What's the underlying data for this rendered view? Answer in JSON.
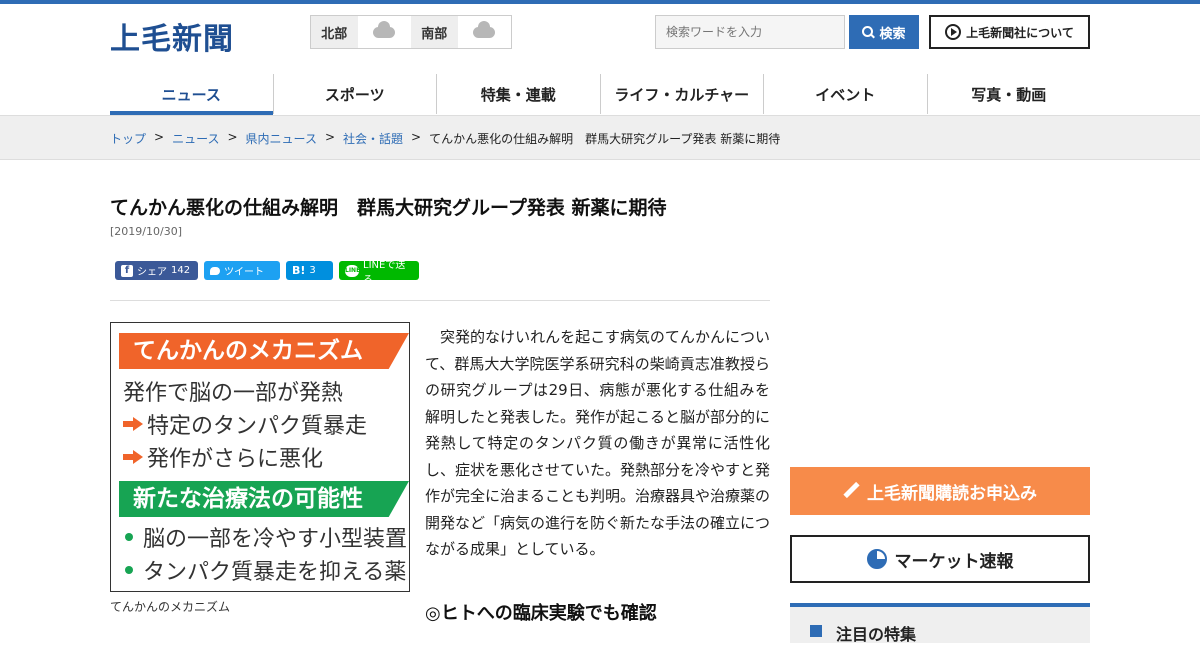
{
  "header": {
    "logo": "上毛新聞",
    "weather": [
      {
        "region": "北部",
        "icon": "cloud-icon"
      },
      {
        "region": "南部",
        "icon": "cloud-icon"
      }
    ],
    "search": {
      "placeholder": "検索ワードを入力",
      "button_label": "検索"
    },
    "about_label": "上毛新聞社について",
    "accent_color": "#2e6cb5"
  },
  "nav": {
    "items": [
      "ニュース",
      "スポーツ",
      "特集・連載",
      "ライフ・カルチャー",
      "イベント",
      "写真・動画"
    ],
    "active": "ニュース"
  },
  "breadcrumb": {
    "links": [
      "トップ",
      "ニュース",
      "県内ニュース",
      "社会・話題"
    ],
    "current": "てんかん悪化の仕組み解明　群馬大研究グループ発表 新薬に期待"
  },
  "article": {
    "title": "てんかん悪化の仕組み解明　群馬大研究グループ発表 新薬に期待",
    "date": "[2019/10/30]",
    "share": {
      "facebook_label": "シェア",
      "facebook_count": "142",
      "twitter_label": "ツイート",
      "hatena_label": "B!",
      "hatena_count": "3",
      "line_label": "LINEで送る"
    },
    "figure": {
      "heading1": "てんかんのメカニズム",
      "lines1": [
        "発作で脳の一部が発熱",
        "特定のタンパク質暴走",
        "発作がさらに悪化"
      ],
      "heading2": "新たな治療法の可能性",
      "lines2": [
        "脳の一部を冷やす小型装置",
        "タンパク質暴走を抑える薬"
      ],
      "caption": "てんかんのメカニズム"
    },
    "body": "突発的なけいれんを起こす病気のてんかんについて、群馬大大学院医学系研究科の柴崎貢志准教授らの研究グループは29日、病態が悪化する仕組みを解明したと発表した。発作が起こると脳が部分的に発熱して特定のタンパク質の働きが異常に活性化し、症状を悪化させていた。発熱部分を冷やすと発作が完全に治まることも判明。治療器具や治療薬の開発など「病気の進行を防ぐ新たな手法の確立につながる成果」としている。",
    "subheading": "◎ヒトへの臨床実験でも確認"
  },
  "sidebar": {
    "subscribe_label": "上毛新聞購読お申込み",
    "subscribe_color": "#f78b4a",
    "market_label": "マーケット速報",
    "featured_label": "注目の特集"
  }
}
